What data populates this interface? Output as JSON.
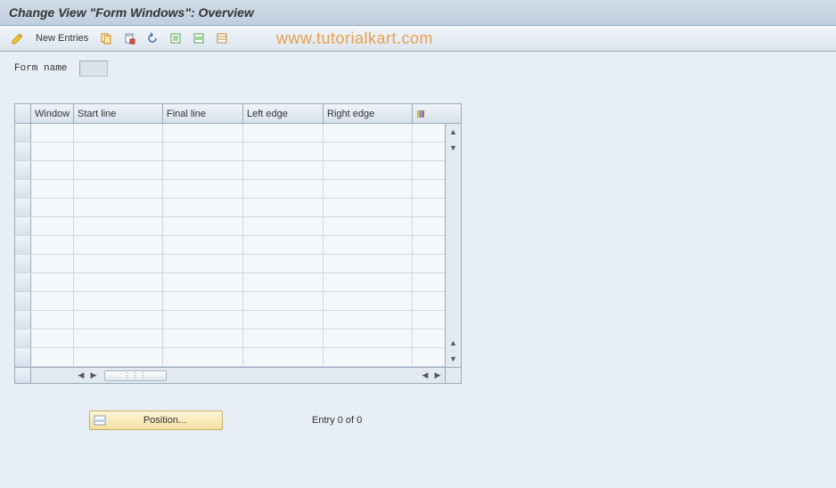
{
  "title": "Change View \"Form Windows\": Overview",
  "toolbar": {
    "new_entries_label": "New Entries"
  },
  "watermark": "www.tutorialkart.com",
  "form": {
    "name_label": "Form name",
    "name_value": ""
  },
  "table": {
    "columns": {
      "window": "Window",
      "start_line": "Start line",
      "final_line": "Final line",
      "left_edge": "Left edge",
      "right_edge": "Right edge"
    },
    "rows": []
  },
  "footer": {
    "position_label": "Position...",
    "entry_status": "Entry 0 of 0"
  }
}
